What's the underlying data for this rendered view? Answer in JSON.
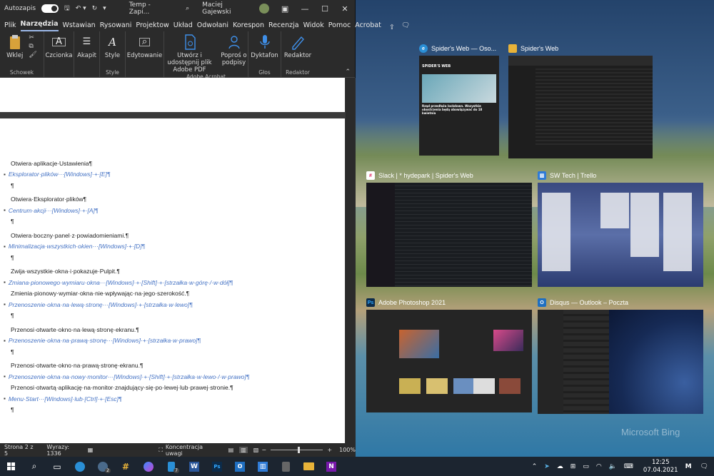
{
  "word": {
    "titlebar": {
      "autosave_label": "Autozapis",
      "doc_title": "Temp  -  Zapi...",
      "user_name": "Maciej Gajewski"
    },
    "menu": [
      "Plik",
      "Narzędzia",
      "Wstawian",
      "Rysowani",
      "Projektow",
      "Układ",
      "Odwołani",
      "Korespon",
      "Recenzja",
      "Widok",
      "Pomoc",
      "Acrobat"
    ],
    "ribbon": {
      "paste_label": "Wklej",
      "clipboard_group": "Schowek",
      "font_label": "Czcionka",
      "paragraph_label": "Akapit",
      "style_label": "Style",
      "style_group": "Style",
      "editing_label": "Edytowanie",
      "create_pdf_label": "Utwórz i udostępnij plik Adobe PDF",
      "request_sign_label": "Poproś o podpisy",
      "acrobat_group": "Adobe Acrobat",
      "dictate_label": "Dyktafon",
      "voice_group": "Głos",
      "editor_label": "Redaktor",
      "editor_group": "Redaktor"
    },
    "document_lines": [
      {
        "text": "Otwiera·aplikacje·Ustawienia¶",
        "type": "text"
      },
      {
        "text": "Eksplorator·plików···[Windows]·+·[E]¶",
        "type": "link"
      },
      {
        "text": "¶",
        "type": "text"
      },
      {
        "text": "Otwiera·Eksplorator·plików¶",
        "type": "text"
      },
      {
        "text": "Centrum·akcji···[Windows]·+·[A]¶",
        "type": "link"
      },
      {
        "text": "¶",
        "type": "text"
      },
      {
        "text": "Otwiera·boczny·panel·z·powiadomieniami.¶",
        "type": "text"
      },
      {
        "text": "Minimalizacja·wszystkich·okien···[Windows]·+·[D]¶",
        "type": "link"
      },
      {
        "text": "¶",
        "type": "text"
      },
      {
        "text": "Zwija·wszystkie·okna·i·pokazuje·Pulpit.¶",
        "type": "text"
      },
      {
        "text": "Zmiana·pionowego·wymiaru·okna···[Windows]·+·[Shift]·+·[strzałka·w·górę·/·w·dół]¶",
        "type": "link"
      },
      {
        "text": "Zmienia·pionowy·wymiar·okna·nie·wpływając·na·jego·szerokość.¶",
        "type": "text"
      },
      {
        "text": "Przenoszenie·okna·na·lewą·stronę···[Windows]·+·[strzałka·w·lewo]¶",
        "type": "link"
      },
      {
        "text": "¶",
        "type": "text"
      },
      {
        "text": "Przenosi·otwarte·okno·na·lewą·stronę·ekranu.¶",
        "type": "text"
      },
      {
        "text": "Przenoszenie·okna·na·prawą·stronę···[Windows]·+·[strzałka·w·prawo]¶",
        "type": "link"
      },
      {
        "text": "¶",
        "type": "text"
      },
      {
        "text": "Przenosi·otwarte·okno·na·prawą·stronę·ekranu.¶",
        "type": "text"
      },
      {
        "text": "Przenoszenie·okna·na·nowy·monitor···[Windows]·+·[Shift]·+·[strzałka·w·lewo·/·w·prawo]¶",
        "type": "link"
      },
      {
        "text": "Przenosi·otwartą·aplikację·na·monitor·znajdujący·się·po·lewej·lub·prawej·stronie.¶",
        "type": "text"
      },
      {
        "text": "Menu·Start···[Windows]·lub·[Ctrl]·+·[Esc]¶",
        "type": "link"
      },
      {
        "text": "¶",
        "type": "text"
      }
    ],
    "status": {
      "page": "Strona 2 z 5",
      "words": "Wyrazy: 1336",
      "focus": "Koncentracja uwagi",
      "zoom": "100%",
      "zoom_fraction": 0.5
    }
  },
  "task_view": {
    "windows": [
      {
        "title": "Spider's Web — Oso...",
        "icon": "edge-icon",
        "color": "#2a8fd6"
      },
      {
        "title": "Spider's Web",
        "icon": "folder-icon",
        "color": "#e8b339"
      },
      {
        "title": "Slack | * hydepark | Spider's Web",
        "icon": "slack-icon",
        "color": "#ffffff"
      },
      {
        "title": "SW Tech | Trello",
        "icon": "trello-icon",
        "color": "#2f7bd6"
      },
      {
        "title": "Adobe Photoshop 2021",
        "icon": "photoshop-icon",
        "color": "#0c2b4a"
      },
      {
        "title": "Disqus — Outlook – Poczta",
        "icon": "outlook-icon",
        "color": "#1f6fc1"
      }
    ],
    "thumb_text": {
      "spider_logo": "SPIDER'S WEB",
      "spider_headline": "Rząd przedłuża lockdown. Wszystkie obostrzenia będą obowiązywać do 18 kwietnia"
    }
  },
  "desktop": {
    "watermark": "Microsoft Bing"
  },
  "taskbar": {
    "time": "12:25",
    "date": "07.04.2021",
    "edge_badge": "2",
    "explorer_badge": "7"
  }
}
